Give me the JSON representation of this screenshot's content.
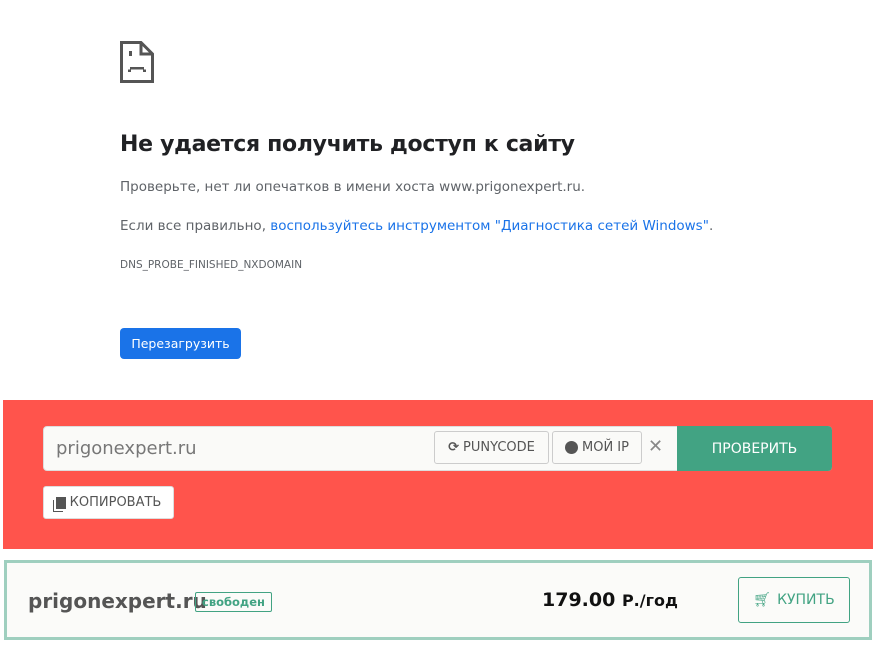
{
  "error": {
    "title": "Не удается получить доступ к сайту",
    "line1": "Проверьте, нет ли опечатков в имени хоста www.prigonexpert.ru.",
    "line2_prefix": "Если все правильно, ",
    "line2_link": "воспользуйтесь инструментом \"Диагностика сетей Windows\"",
    "line2_suffix": ".",
    "code": "DNS_PROBE_FINISHED_NXDOMAIN",
    "reload": "Перезагрузить"
  },
  "checker": {
    "input_value": "prigonexpert.ru",
    "punycode": "PUNYCODE",
    "my_ip": "МОЙ IP",
    "clear": "✕",
    "check": "ПРОВЕРИТЬ",
    "copy": "КОПИРОВАТЬ"
  },
  "result": {
    "domain": "prigonexpert.ru",
    "status": "свободен",
    "price": "179.00",
    "unit": "Р./год",
    "buy": "КУПИТЬ"
  }
}
